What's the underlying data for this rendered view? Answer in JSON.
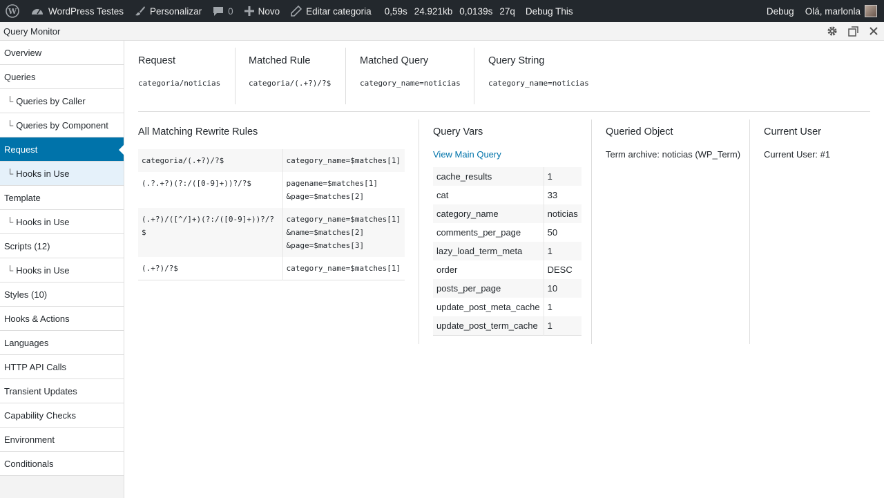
{
  "adminbar": {
    "site_name": "WordPress Testes",
    "customize": "Personalizar",
    "comments_count": "0",
    "new_label": "Novo",
    "edit_label": "Editar categoria",
    "qm_stats": [
      "0,59s",
      "24.921kb",
      "0,0139s",
      "27q"
    ],
    "debug_this": "Debug This",
    "debug": "Debug",
    "greeting": "Olá, marlonla"
  },
  "qm": {
    "title": "Query Monitor",
    "nav": [
      {
        "label": "Overview",
        "sub": false
      },
      {
        "label": "Queries",
        "sub": false
      },
      {
        "label": "Queries by Caller",
        "sub": true
      },
      {
        "label": "Queries by Component",
        "sub": true
      },
      {
        "label": "Request",
        "sub": false,
        "active": true
      },
      {
        "label": "Hooks in Use",
        "sub": true,
        "active_sub": true
      },
      {
        "label": "Template",
        "sub": false
      },
      {
        "label": "Hooks in Use",
        "sub": true
      },
      {
        "label": "Scripts (12)",
        "sub": false
      },
      {
        "label": "Hooks in Use",
        "sub": true
      },
      {
        "label": "Styles (10)",
        "sub": false
      },
      {
        "label": "Hooks & Actions",
        "sub": false
      },
      {
        "label": "Languages",
        "sub": false
      },
      {
        "label": "HTTP API Calls",
        "sub": false
      },
      {
        "label": "Transient Updates",
        "sub": false
      },
      {
        "label": "Capability Checks",
        "sub": false
      },
      {
        "label": "Environment",
        "sub": false
      },
      {
        "label": "Conditionals",
        "sub": false
      }
    ],
    "nav_prefix": "└",
    "request": {
      "request_title": "Request",
      "request_value": "categoria/noticias",
      "matched_rule_title": "Matched Rule",
      "matched_rule_value": "categoria/(.+?)/?$",
      "matched_query_title": "Matched Query",
      "matched_query_value": "category_name=noticias",
      "query_string_title": "Query String",
      "query_string_value": "category_name=noticias"
    },
    "rewrite": {
      "title": "All Matching Rewrite Rules",
      "rows": [
        {
          "rule": "categoria/(.+?)/?$",
          "query": [
            "category_name=$matches[1]"
          ]
        },
        {
          "rule": "(.?.+?)(?:/([0-9]+))?/?$",
          "query": [
            "pagename=$matches[1]",
            "&page=$matches[2]"
          ]
        },
        {
          "rule": "(.+?)/([^/]+)(?:/([0-9]+))?/?$",
          "query": [
            "category_name=$matches[1]",
            "&name=$matches[2]",
            "&page=$matches[3]"
          ]
        },
        {
          "rule": "(.+?)/?$",
          "query": [
            "category_name=$matches[1]"
          ]
        }
      ]
    },
    "query_vars": {
      "title": "Query Vars",
      "link": "View Main Query",
      "rows": [
        {
          "key": "cache_results",
          "value": "1"
        },
        {
          "key": "cat",
          "value": "33"
        },
        {
          "key": "category_name",
          "value": "noticias"
        },
        {
          "key": "comments_per_page",
          "value": "50"
        },
        {
          "key": "lazy_load_term_meta",
          "value": "1"
        },
        {
          "key": "order",
          "value": "DESC"
        },
        {
          "key": "posts_per_page",
          "value": "10"
        },
        {
          "key": "update_post_meta_cache",
          "value": "1"
        },
        {
          "key": "update_post_term_cache",
          "value": "1"
        }
      ]
    },
    "queried_object": {
      "title": "Queried Object",
      "value": "Term archive: noticias (WP_Term)"
    },
    "current_user": {
      "title": "Current User",
      "value": "Current User: #1"
    }
  }
}
